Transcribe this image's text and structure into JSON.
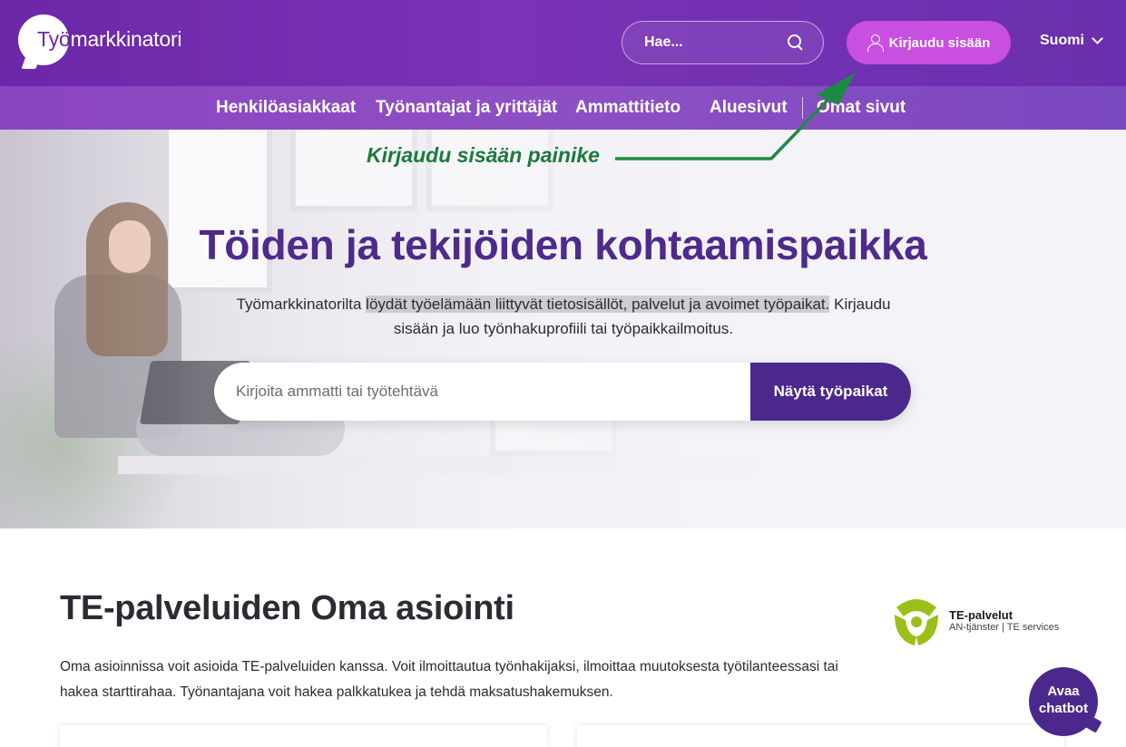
{
  "header": {
    "logo_first": "Työ",
    "logo_rest": "markkinatori",
    "search_placeholder": "Hae...",
    "login_label": "Kirjaudu sisään",
    "language": "Suomi"
  },
  "nav": {
    "items": [
      {
        "label": "Henkilöasiakkaat"
      },
      {
        "label": "Työnantajat ja yrittäjät"
      },
      {
        "label": "Ammattitieto"
      },
      {
        "label": "Aluesivut"
      },
      {
        "label": "Omat sivut"
      }
    ]
  },
  "annotation": {
    "text": "Kirjaudu sisään painike",
    "color": "#1d7a3c"
  },
  "hero": {
    "title": "Töiden ja tekijöiden kohtaamispaikka",
    "text_before": "Työmarkkinatorilta ",
    "text_highlight": "löydät työelämään liittyvät tietosisällöt, palvelut ja avoimet työpaikat.",
    "text_after": " Kirjaudu sisään ja luo työnhakuprofiili tai työpaikkailmoitus.",
    "search_placeholder": "Kirjoita ammatti tai työtehtävä",
    "search_button": "Näytä työpaikat"
  },
  "section": {
    "title": "TE-palveluiden Oma asiointi",
    "text": "Oma asioinnissa voit asioida TE-palveluiden kanssa. Voit ilmoittautua työnhakijaksi, ilmoittaa muutoksesta työtilanteessasi tai hakea starttirahaa. Työnantajana voit hakea palkkatukea ja tehdä maksatushakemuksen."
  },
  "te_logo": {
    "name": "TE-palvelut",
    "subtitle": "AN-tjänster | TE services"
  },
  "chatbot": {
    "line1": "Avaa",
    "line2": "chatbot"
  },
  "colors": {
    "header_purple": "#6c27a8",
    "login_pink": "#c84fe0",
    "title_purple": "#4d2a8c",
    "button_purple": "#4b288c",
    "te_green": "#9bbf1a"
  }
}
